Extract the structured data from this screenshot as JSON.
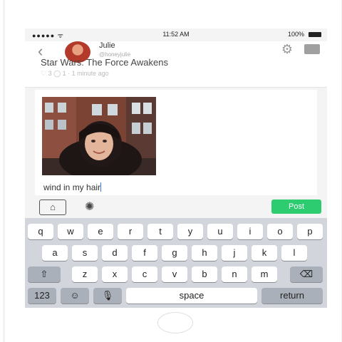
{
  "statusbar": {
    "carrier": "●●●●● ᯤ",
    "time": "11:52 AM",
    "battery": "100%"
  },
  "navbar": {
    "back": "‹",
    "name": "Julie",
    "handle": "@honeyjulie"
  },
  "feed": {
    "text": "Star Wars: The Force Awakens",
    "meta": "♡ 3  ◯ 1 · 1 minute ago"
  },
  "compose": {
    "text": "wind in my hair"
  },
  "tools": {
    "camera": "⌂",
    "bulb": "✺",
    "post": "Post"
  },
  "keyboard": {
    "row1": [
      "q",
      "w",
      "e",
      "r",
      "t",
      "y",
      "u",
      "i",
      "o",
      "p"
    ],
    "row2": [
      "a",
      "s",
      "d",
      "f",
      "g",
      "h",
      "j",
      "k",
      "l"
    ],
    "row3": [
      "z",
      "x",
      "c",
      "v",
      "b",
      "n",
      "m"
    ],
    "shift": "⇧",
    "backspace": "⌫",
    "numbers": "123",
    "emoji": "☺",
    "mic": "🎙",
    "space": "space",
    "return": "return"
  },
  "colors": {
    "accent": "#2ecc71",
    "cursor": "#3b7ae0",
    "keyboard_bg": "#d2d5db"
  },
  "icons": {
    "settings": "gear-icon",
    "inbox": "inbox-icon",
    "back": "chevron-left-icon"
  }
}
